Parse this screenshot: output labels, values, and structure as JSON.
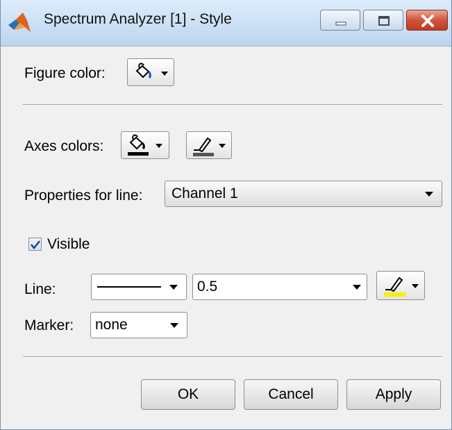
{
  "window": {
    "title": "Spectrum Analyzer [1] - Style",
    "controls": [
      "minimize-icon",
      "maximize-icon",
      "close-icon"
    ],
    "close_color": "#c8452d"
  },
  "figure": {
    "label": "Figure color:"
  },
  "axes": {
    "label": "Axes colors:"
  },
  "properties": {
    "label": "Properties for line:",
    "selected": "Channel 1"
  },
  "visible": {
    "label": "Visible",
    "checked": true
  },
  "line": {
    "label": "Line:",
    "style_value": "solid",
    "width_value": "0.5",
    "color": "#f2f200"
  },
  "marker": {
    "label": "Marker:",
    "value": "none"
  },
  "buttons": {
    "ok": "OK",
    "cancel": "Cancel",
    "apply": "Apply"
  }
}
